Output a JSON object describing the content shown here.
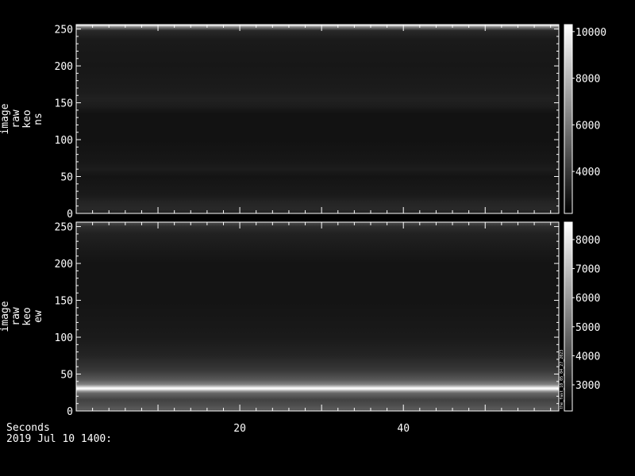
{
  "footer": {
    "xlabel": "Seconds",
    "date_label": "2019 Jul 10 1400:"
  },
  "chart_data": [
    {
      "type": "heatmap",
      "ylabel_lines": [
        "image",
        "raw",
        "keo",
        "ns"
      ],
      "x_ticks": [
        20,
        40
      ],
      "xlim": [
        0,
        59
      ],
      "y_ticks": [
        0,
        50,
        100,
        150,
        200,
        250
      ],
      "ylim": [
        0,
        256
      ],
      "colorbar": {
        "ticks": [
          4000,
          6000,
          8000,
          10000
        ],
        "range": [
          2200,
          10300
        ]
      },
      "row_profile": [
        {
          "y": 0,
          "v": 0.12
        },
        {
          "y": 5,
          "v": 0.16
        },
        {
          "y": 15,
          "v": 0.14
        },
        {
          "y": 25,
          "v": 0.1
        },
        {
          "y": 50,
          "v": 0.08
        },
        {
          "y": 60,
          "v": 0.11
        },
        {
          "y": 70,
          "v": 0.09
        },
        {
          "y": 100,
          "v": 0.07
        },
        {
          "y": 135,
          "v": 0.07
        },
        {
          "y": 145,
          "v": 0.11
        },
        {
          "y": 155,
          "v": 0.13
        },
        {
          "y": 165,
          "v": 0.11
        },
        {
          "y": 200,
          "v": 0.09
        },
        {
          "y": 235,
          "v": 0.1
        },
        {
          "y": 248,
          "v": 0.16
        },
        {
          "y": 253,
          "v": 0.55
        },
        {
          "y": 255,
          "v": 0.95
        },
        {
          "y": 256,
          "v": 0.5
        }
      ]
    },
    {
      "type": "heatmap",
      "ylabel_lines": [
        "image",
        "raw",
        "keo",
        "ew"
      ],
      "x_ticks": [
        20,
        40
      ],
      "xlim": [
        0,
        59
      ],
      "y_ticks": [
        0,
        50,
        100,
        150,
        200,
        250
      ],
      "ylim": [
        0,
        256
      ],
      "colorbar": {
        "ticks": [
          3000,
          4000,
          5000,
          6000,
          7000,
          8000
        ],
        "range": [
          2100,
          8600
        ],
        "annotation": "the_fast_10_05_04_27_2023"
      },
      "row_profile": [
        {
          "y": 0,
          "v": 0.3
        },
        {
          "y": 3,
          "v": 0.35
        },
        {
          "y": 8,
          "v": 0.3
        },
        {
          "y": 15,
          "v": 0.26
        },
        {
          "y": 24,
          "v": 0.4
        },
        {
          "y": 27,
          "v": 0.62
        },
        {
          "y": 29,
          "v": 0.9
        },
        {
          "y": 31,
          "v": 1.0
        },
        {
          "y": 33,
          "v": 0.78
        },
        {
          "y": 36,
          "v": 0.5
        },
        {
          "y": 42,
          "v": 0.35
        },
        {
          "y": 55,
          "v": 0.22
        },
        {
          "y": 75,
          "v": 0.14
        },
        {
          "y": 100,
          "v": 0.1
        },
        {
          "y": 150,
          "v": 0.08
        },
        {
          "y": 200,
          "v": 0.08
        },
        {
          "y": 220,
          "v": 0.1
        },
        {
          "y": 240,
          "v": 0.13
        },
        {
          "y": 250,
          "v": 0.18
        },
        {
          "y": 256,
          "v": 0.3
        }
      ]
    }
  ]
}
